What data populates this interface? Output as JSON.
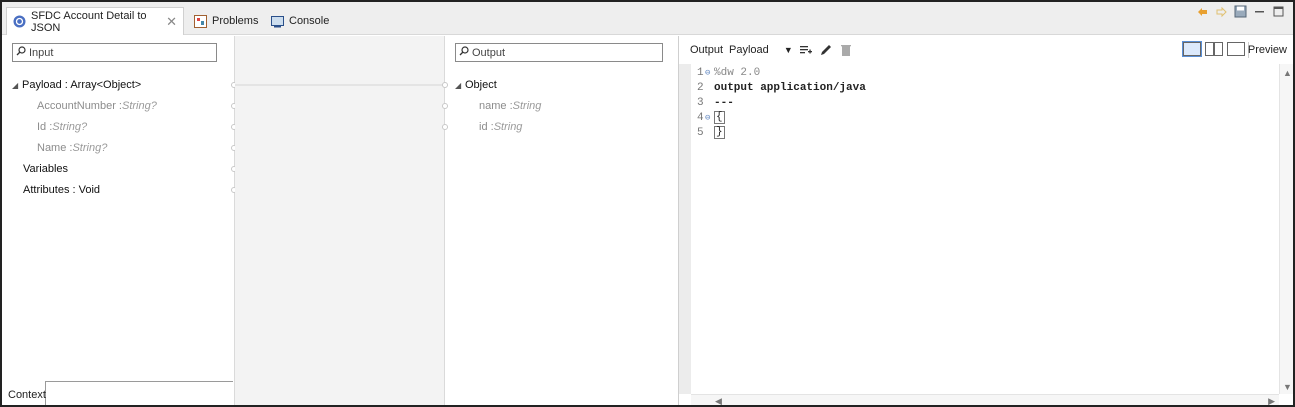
{
  "tabs": [
    {
      "label": "SFDC Account Detail to JSON",
      "icon": "dataweave-icon",
      "active": true
    },
    {
      "label": "Problems",
      "icon": "problems-icon"
    },
    {
      "label": "Console",
      "icon": "console-icon"
    }
  ],
  "input_panel": {
    "search_placeholder": "Input",
    "tree": [
      {
        "name": "Payload : Array<Object>",
        "type": "",
        "expanded": true
      },
      {
        "name": "AccountNumber : ",
        "type": "String?"
      },
      {
        "name": "Id : ",
        "type": "String?"
      },
      {
        "name": "Name : ",
        "type": "String?"
      },
      {
        "name": "Variables",
        "type": ""
      },
      {
        "name": "Attributes : Void",
        "type": ""
      }
    ],
    "context_label": "Context"
  },
  "output_panel": {
    "search_placeholder": "Output",
    "tree": [
      {
        "name": "Object",
        "type": "",
        "expanded": true
      },
      {
        "name": "name : ",
        "type": "String"
      },
      {
        "name": "id : ",
        "type": "String"
      }
    ]
  },
  "script_panel": {
    "output_label": "Output",
    "payload_label": "Payload",
    "preview_label": "Preview",
    "lines": [
      {
        "num": "1",
        "text": "%dw 2.0"
      },
      {
        "num": "2",
        "text": "output application/java"
      },
      {
        "num": "3",
        "text": "---"
      },
      {
        "num": "4",
        "text": "{"
      },
      {
        "num": "5",
        "text": "}"
      }
    ]
  },
  "colors": {
    "accent": "#5a8fd6",
    "mapping_bg": "#f3f3f3",
    "tab_bar": "#eeeeee"
  }
}
